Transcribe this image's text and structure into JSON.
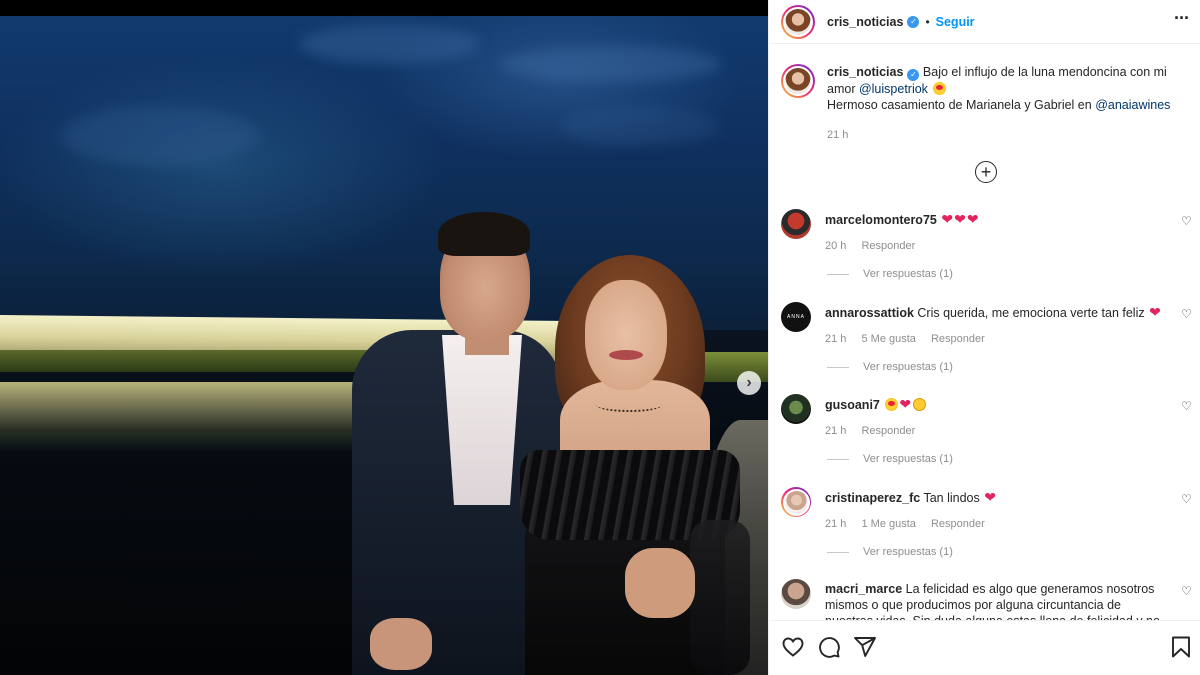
{
  "post": {
    "username": "cris_noticias",
    "verified": true,
    "follow_label": "Seguir",
    "more_label": "···"
  },
  "caption": {
    "username": "cris_noticias",
    "text_1": "Bajo el influjo de la luna mendoncina con mi amor",
    "mention_1": "@luispetriok",
    "line_2": "Hermoso casamiento de Marianela y Gabriel en",
    "mention_2": "@anaiawines",
    "time": "21 h"
  },
  "add_button_label": "+",
  "carousel_next": "›",
  "comments": [
    {
      "username": "marcelomontero75",
      "text": "",
      "hearts": 3,
      "time": "20 h",
      "likes": "",
      "reply_label": "Responder",
      "replies_label": "Ver respuestas (1)"
    },
    {
      "username": "annarossattiok",
      "text": "Cris querida, me emociona verte tan feliz",
      "hearts": 1,
      "time": "21 h",
      "likes": "5 Me gusta",
      "reply_label": "Responder",
      "replies_label": "Ver respuestas (1)"
    },
    {
      "username": "gusoani7",
      "text": "",
      "hearts": 1,
      "time": "21 h",
      "likes": "",
      "reply_label": "Responder",
      "replies_label": "Ver respuestas (1)"
    },
    {
      "username": "cristinaperez_fc",
      "text": "Tan lindos",
      "hearts": 1,
      "time": "21 h",
      "likes": "1 Me gusta",
      "reply_label": "Responder",
      "replies_label": "Ver respuestas (1)"
    },
    {
      "username": "macri_marce",
      "text": "La felicidad es algo que generamos nosotros mismos o que producimos por alguna circuntancia de nuestras vidas. Sin duda alguna estas llena de felicidad y no por una"
    }
  ],
  "anna_avatar_text": "ANNA",
  "icons": {
    "verified": "verified-badge-icon",
    "like": "heart-outline-icon",
    "comment": "speech-bubble-icon",
    "share": "paper-plane-icon",
    "save": "bookmark-icon",
    "add": "plus-circle-icon",
    "next": "chevron-right-icon"
  },
  "colors": {
    "link": "#00376b",
    "follow": "#0095f6",
    "heart": "#e0245e",
    "muted": "#8e8e8e",
    "text": "#262626"
  }
}
